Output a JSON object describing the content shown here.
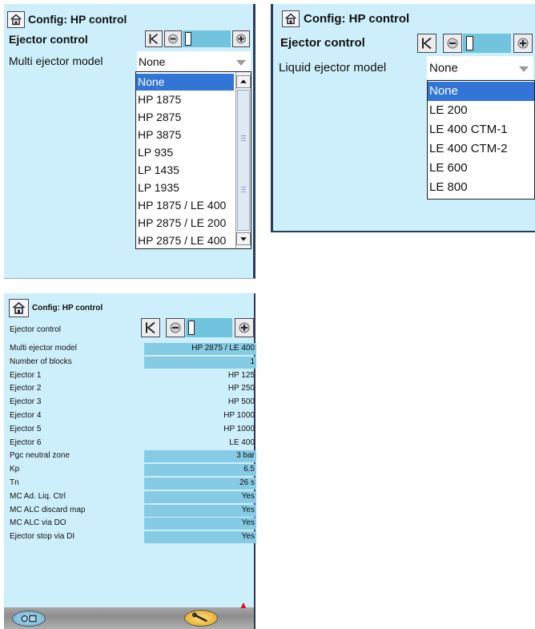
{
  "screen1": {
    "title": "Config: HP control",
    "section": "Ejector control",
    "field_label": "Multi ejector model",
    "field_value": "None",
    "options": [
      "None",
      "HP 1875",
      "HP 2875",
      "HP 3875",
      "LP 935",
      "LP 1435",
      "LP 1935",
      "HP 1875 / LE 400",
      "HP 2875 / LE 200",
      "HP 2875 / LE 400"
    ],
    "selected": "None"
  },
  "screen2": {
    "title": "Config: HP control",
    "section": "Ejector control",
    "field_label": "Liquid ejector model",
    "field_value": "None",
    "options": [
      "None",
      "LE 200",
      "LE 400 CTM-1",
      "LE 400 CTM-2",
      "LE 600",
      "LE 800"
    ],
    "selected": "None"
  },
  "screen3": {
    "title": "Config: HP control",
    "section": "Ejector control",
    "rows": [
      {
        "label": "Multi ejector model",
        "value": "HP 2875 / LE 400",
        "editable": true
      },
      {
        "label": "Number of blocks",
        "value": "1",
        "editable": true
      },
      {
        "label": "Ejector 1",
        "value": "HP 125",
        "editable": false
      },
      {
        "label": "Ejector 2",
        "value": "HP 250",
        "editable": false
      },
      {
        "label": "Ejector 3",
        "value": "HP 500",
        "editable": false
      },
      {
        "label": "Ejector 4",
        "value": "HP 1000",
        "editable": false
      },
      {
        "label": "Ejector 5",
        "value": "HP 1000",
        "editable": false
      },
      {
        "label": "Ejector 6",
        "value": "LE 400",
        "editable": false
      },
      {
        "label": "Pgc neutral zone",
        "value": "3 bar",
        "editable": true
      },
      {
        "label": "Kp",
        "value": "6.5",
        "editable": true
      },
      {
        "label": "Tn",
        "value": "26 s",
        "editable": true
      },
      {
        "label": "MC Ad. Liq. Ctrl",
        "value": "Yes",
        "editable": true
      },
      {
        "label": "MC ALC discard map",
        "value": "Yes",
        "editable": true
      },
      {
        "label": "MC ALC via DO",
        "value": "Yes",
        "editable": true
      },
      {
        "label": "Ejector stop via DI",
        "value": "Yes",
        "editable": true
      }
    ]
  },
  "colors": {
    "panel_bg": "#cdeffb",
    "editable_cell": "#85cbe5",
    "selected_option": "#3375d6",
    "alarm": "#e01010"
  },
  "icons": [
    "home-icon",
    "first-page-icon",
    "previous-page-icon",
    "page-indicator-icon",
    "next-page-icon",
    "scroll-up-icon",
    "scroll-down-icon",
    "login-icon",
    "service-tool-icon",
    "alarm-bell-icon"
  ]
}
